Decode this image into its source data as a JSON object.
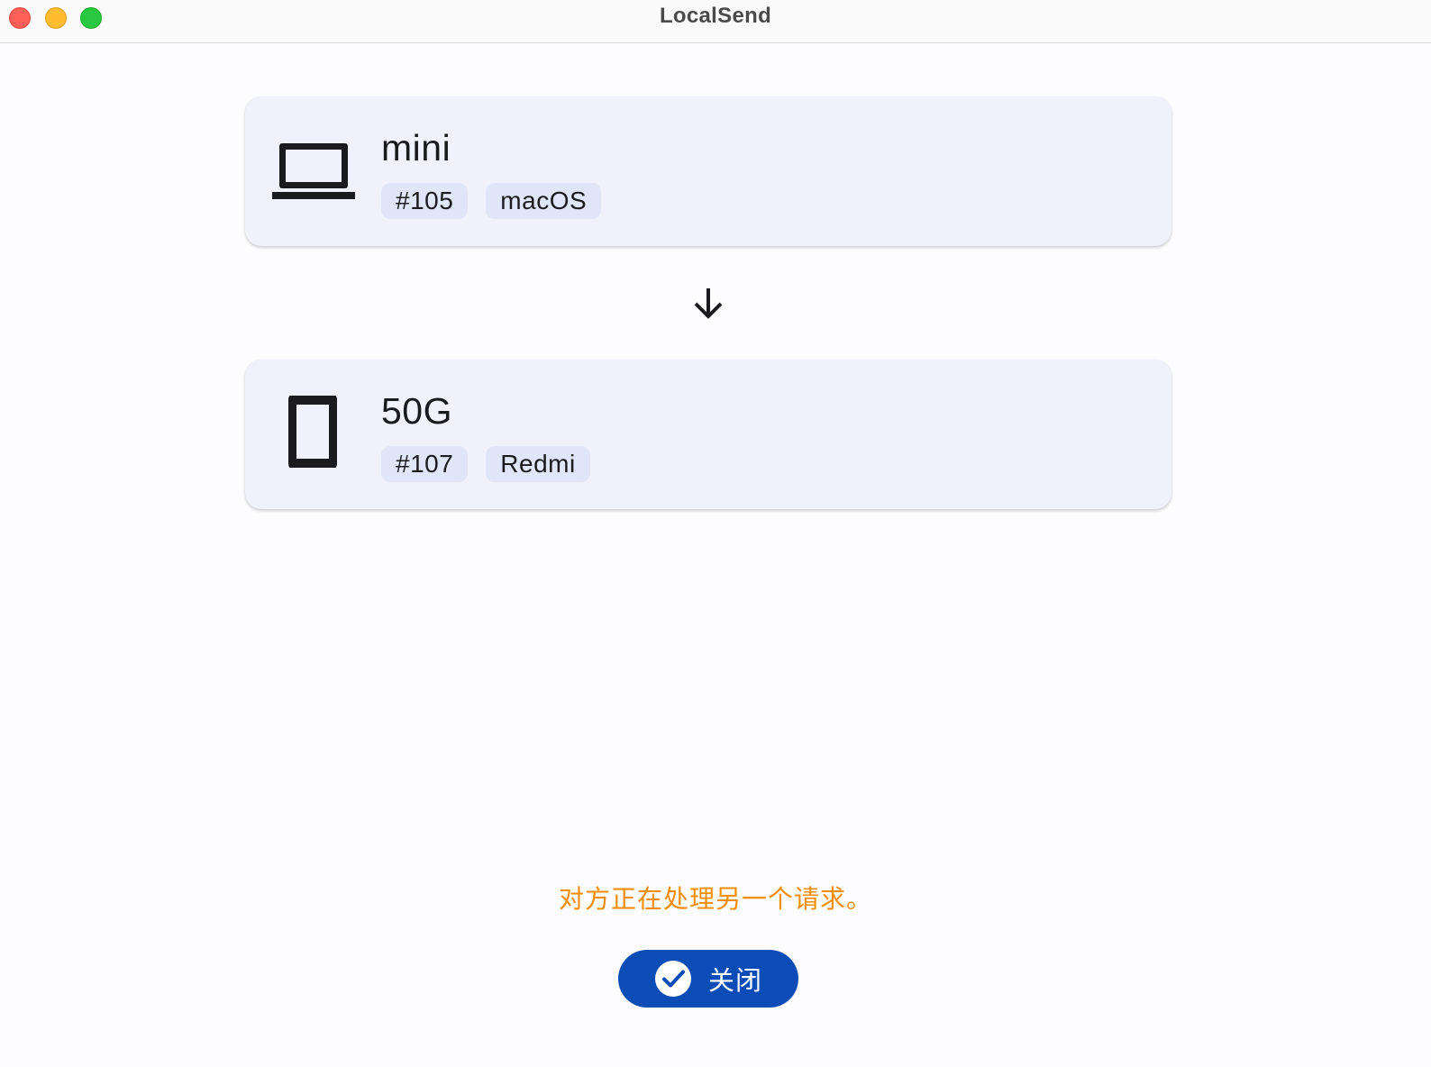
{
  "window": {
    "title": "LocalSend"
  },
  "sender": {
    "icon": "laptop-icon",
    "name": "mini",
    "tags": [
      "#105",
      "macOS"
    ]
  },
  "receiver": {
    "icon": "phone-icon",
    "name": "50G",
    "tags": [
      "#107",
      "Redmi"
    ]
  },
  "transfer": {
    "direction_icon": "arrow-down-icon"
  },
  "status": {
    "message": "对方正在处理另一个请求。",
    "color": "#f28c00"
  },
  "actions": {
    "close_label": "关闭",
    "close_icon": "check-circle-icon",
    "accent": "#0b4cb6"
  }
}
